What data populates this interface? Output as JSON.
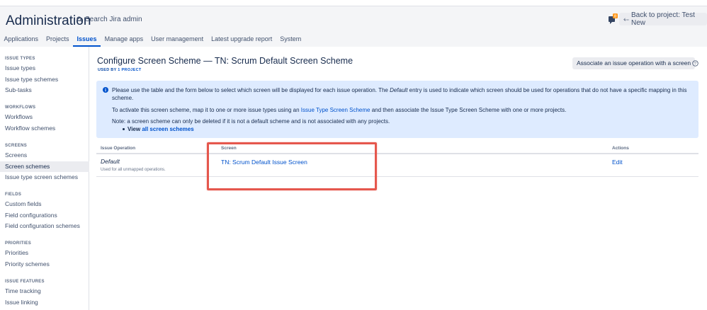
{
  "header": {
    "title": "Administration",
    "search_placeholder": "Search Jira admin",
    "notification_badge": "8",
    "back_button": "Back to project: Test New"
  },
  "nav": {
    "items": [
      "Applications",
      "Projects",
      "Issues",
      "Manage apps",
      "User management",
      "Latest upgrade report",
      "System"
    ],
    "active": "Issues"
  },
  "sidebar": {
    "groups": [
      {
        "heading": "ISSUE TYPES",
        "items": [
          "Issue types",
          "Issue type schemes",
          "Sub-tasks"
        ]
      },
      {
        "heading": "WORKFLOWS",
        "items": [
          "Workflows",
          "Workflow schemes"
        ]
      },
      {
        "heading": "SCREENS",
        "items": [
          "Screens",
          "Screen schemes",
          "Issue type screen schemes"
        ]
      },
      {
        "heading": "FIELDS",
        "items": [
          "Custom fields",
          "Field configurations",
          "Field configuration schemes"
        ]
      },
      {
        "heading": "PRIORITIES",
        "items": [
          "Priorities",
          "Priority schemes"
        ]
      },
      {
        "heading": "ISSUE FEATURES",
        "items": [
          "Time tracking",
          "Issue linking"
        ]
      }
    ],
    "active_item": "Screen schemes"
  },
  "page": {
    "title": "Configure Screen Scheme — TN: Scrum Default Screen Scheme",
    "used_by_prefix": "USED BY ",
    "used_by_link": "1 PROJECT",
    "associate_button": "Associate an issue operation with a screen"
  },
  "info": {
    "p1_before": "Please use the table and the form below to select which screen will be displayed for each issue operation. The ",
    "p1_italic": "Default",
    "p1_after": " entry is used to indicate which screen should be used for operations that do not have a specific mapping in this scheme.",
    "p2_before": "To activate this screen scheme, map it to one or more issue types using an ",
    "p2_link": "Issue Type Screen Scheme",
    "p2_after": " and then associate the Issue Type Screen Scheme with one or more projects.",
    "p3": "Note: a screen scheme can only be deleted if it is not a default scheme and is not associated with any projects.",
    "p4_prefix": "View ",
    "p4_link": "all screen schemes"
  },
  "table": {
    "headers": {
      "operation": "Issue Operation",
      "screen": "Screen",
      "actions": "Actions"
    },
    "rows": [
      {
        "operation": "Default",
        "description": "Used for all unmapped operations.",
        "screen": "TN: Scrum Default Issue Screen",
        "action": "Edit"
      }
    ]
  },
  "colors": {
    "accent": "#0052cc",
    "info_background": "#deebff",
    "highlight_border": "#e5574d"
  }
}
